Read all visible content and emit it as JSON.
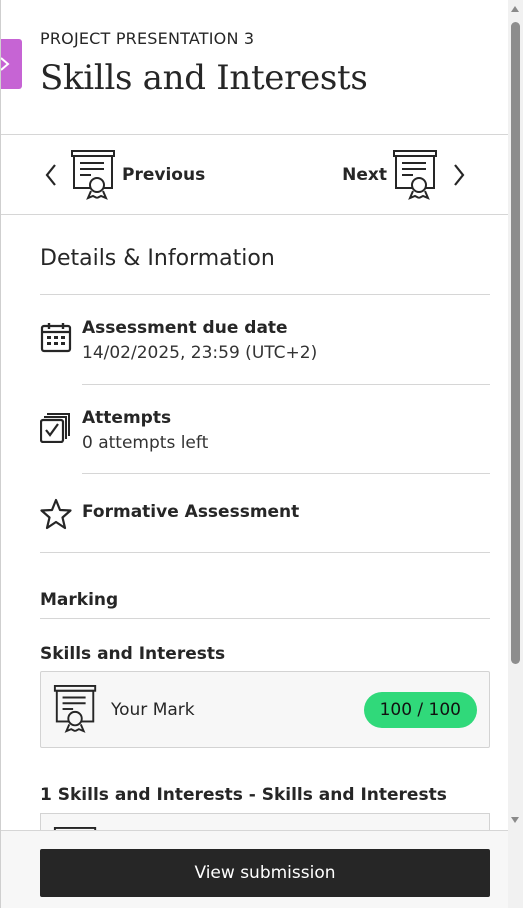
{
  "header": {
    "eyebrow": "PROJECT PRESENTATION 3",
    "title": "Skills and Interests"
  },
  "nav": {
    "previous_label": "Previous",
    "next_label": "Next"
  },
  "details": {
    "heading": "Details & Information",
    "due_date": {
      "title": "Assessment due date",
      "value": "14/02/2025, 23:59 (UTC+2)",
      "icon": "calendar-icon"
    },
    "attempts": {
      "title": "Attempts",
      "value": "0 attempts left",
      "icon": "attempts-checkbox-icon"
    },
    "formative": {
      "title": "Formative Assessment",
      "icon": "star-icon"
    }
  },
  "marking": {
    "label": "Marking",
    "item_heading": "Skills and Interests",
    "your_mark_label": "Your Mark",
    "score": "100 / 100",
    "rubric_heading": "1 Skills and Interests - Skills and Interests"
  },
  "footer": {
    "view_submission_label": "View submission"
  },
  "colors": {
    "accent_tab": "#c664d4",
    "score_badge": "#30d97a",
    "primary_button": "#262626"
  }
}
